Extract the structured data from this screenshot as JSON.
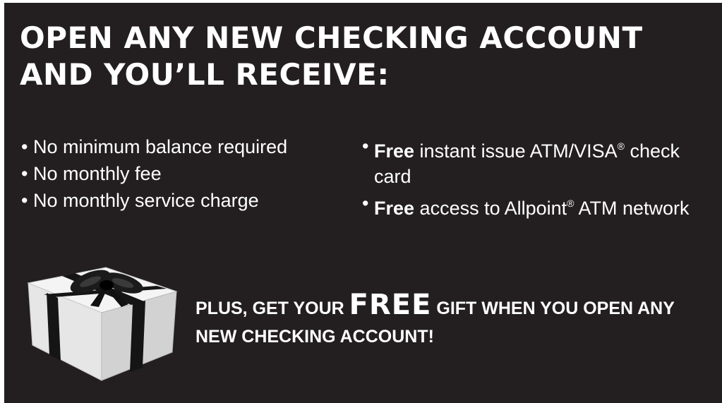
{
  "headline": {
    "line1": "OPEN ANY NEW CHECKING ACCOUNT",
    "line2": "AND YOU’LL RECEIVE:"
  },
  "bullet_marker": "•",
  "benefits_left": [
    "No minimum balance required",
    "No monthly fee",
    "No monthly service charge"
  ],
  "benefits_right": [
    {
      "emphasis": "Free",
      "text_before_mark": " instant issue ATM/VISA",
      "mark": "®",
      "text_after_mark": " check card"
    },
    {
      "emphasis": "Free",
      "text_before_mark": " access to Allpoint",
      "mark": "®",
      "text_after_mark": " ATM network"
    }
  ],
  "promo": {
    "lead": "PLUS, GET YOUR ",
    "emphasis": "FREE",
    "tail": " GIFT WHEN YOU OPEN ANY NEW CHECKING ACCOUNT!"
  },
  "colors": {
    "background": "#231f20",
    "text": "#ffffff",
    "gift_box": "#f2f2f2",
    "ribbon": "#111111"
  },
  "gift_icon": "gift-box-with-black-ribbon-icon"
}
